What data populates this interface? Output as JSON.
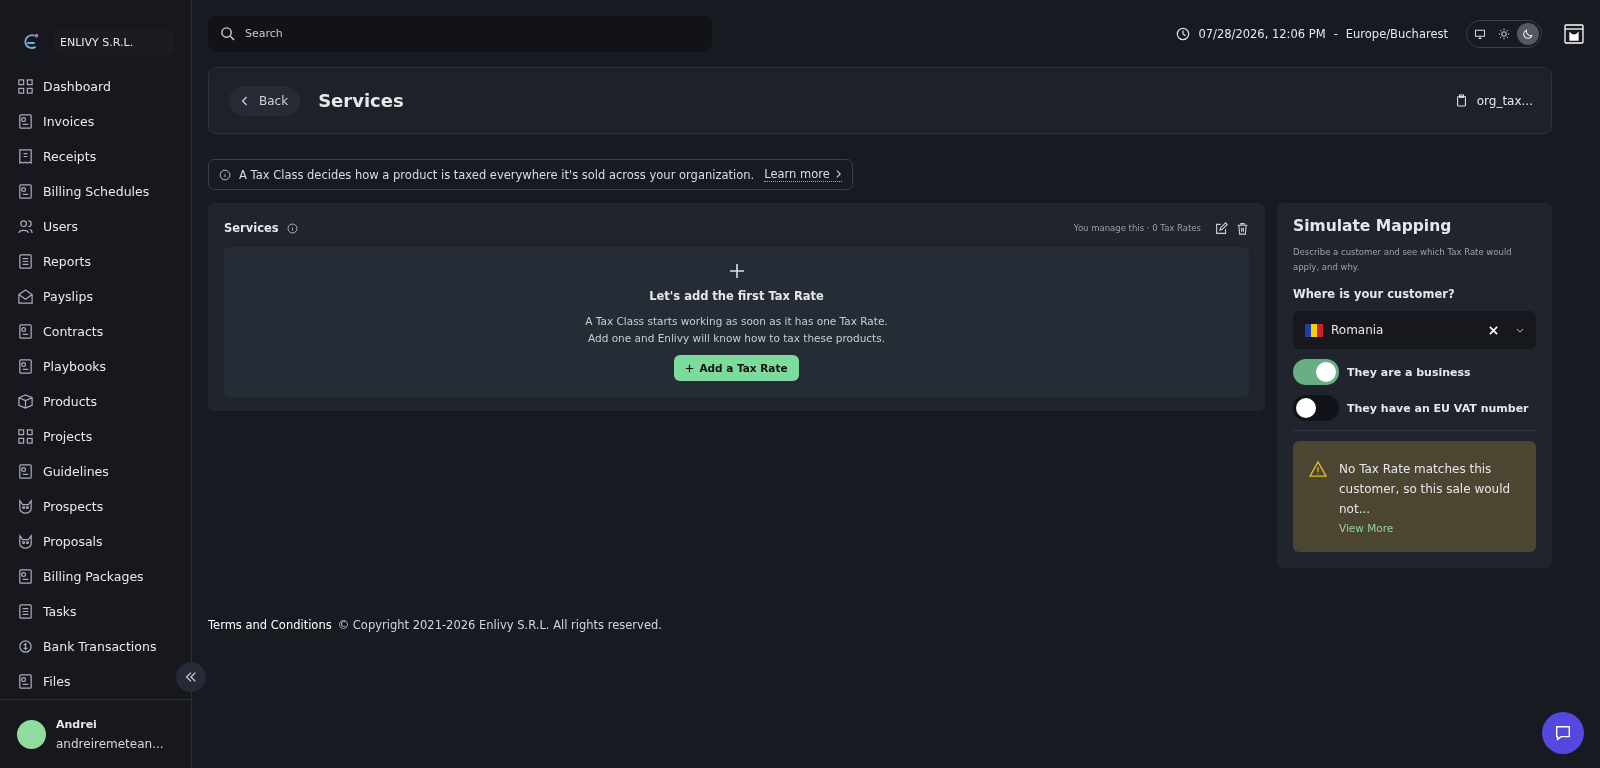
{
  "sidebar": {
    "org_name": "ENLIVY S.R.L.",
    "items": [
      {
        "label": "Dashboard",
        "selected": false
      },
      {
        "label": "Invoices",
        "selected": false
      },
      {
        "label": "Receipts",
        "selected": false
      },
      {
        "label": "Billing Schedules",
        "selected": false
      },
      {
        "label": "Users",
        "selected": false
      },
      {
        "label": "Reports",
        "selected": false
      },
      {
        "label": "Payslips",
        "selected": false
      },
      {
        "label": "Contracts",
        "selected": false
      },
      {
        "label": "Playbooks",
        "selected": false
      },
      {
        "label": "Products",
        "selected": false
      },
      {
        "label": "Projects",
        "selected": false
      },
      {
        "label": "Guidelines",
        "selected": false
      },
      {
        "label": "Prospects",
        "selected": false
      },
      {
        "label": "Proposals",
        "selected": false
      },
      {
        "label": "Billing Packages",
        "selected": false
      },
      {
        "label": "Tasks",
        "selected": false
      },
      {
        "label": "Bank Transactions",
        "selected": false
      },
      {
        "label": "Files",
        "selected": false
      }
    ],
    "user": {
      "name": "Andrei",
      "email": "andreiremetean..."
    }
  },
  "topbar": {
    "search": {
      "placeholder": "Search"
    },
    "datetime": "07/28/2026, 12:06 PM",
    "separator": "-",
    "timezone": "Europe/Bucharest",
    "theme_options": [
      {
        "kind": "system",
        "selected": false
      },
      {
        "kind": "light",
        "selected": false
      },
      {
        "kind": "dark",
        "selected": true
      }
    ]
  },
  "header": {
    "back": "Back",
    "title": "Services",
    "id": "org_tax..."
  },
  "notice": {
    "text": "A Tax Class decides how a product is taxed everywhere it's sold across your organization.",
    "link": "Learn more"
  },
  "tax_class": {
    "title": "Services",
    "meta": "You manage this · 0 Tax Rates",
    "empty_title": "Let's add the first Tax Rate",
    "empty_lines": [
      "A Tax Class starts working as soon as it has one Tax Rate.",
      "Add one and Enlivy will know how to tax these products."
    ],
    "add_button": "Add a Tax Rate"
  },
  "simulate": {
    "title": "Simulate Mapping",
    "description": "Describe a customer and see which Tax Rate would apply, and why.",
    "question": "Where is your customer?",
    "country": "Romania",
    "toggles": [
      {
        "label": "They are a business",
        "on": true
      },
      {
        "label": "They have an EU VAT number",
        "on": false
      }
    ],
    "alert": {
      "text": "No Tax Rate matches this customer, so this sale would not...",
      "link": "View More"
    }
  },
  "footer": {
    "terms": "Terms and Conditions",
    "copyright": "© Copyright 2021-2026 Enlivy S.R.L. All rights reserved."
  }
}
